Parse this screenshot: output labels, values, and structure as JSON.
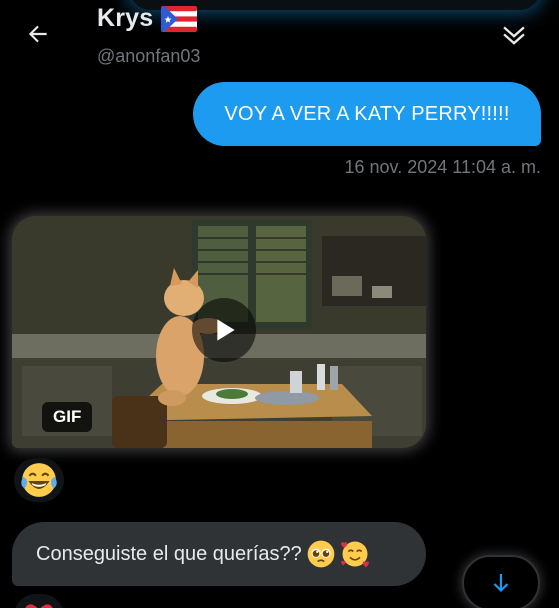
{
  "header": {
    "display_name": "Krys",
    "handle": "@anonfan03",
    "flag_icon": "puerto-rico-flag-icon",
    "back_icon": "arrow-left-icon",
    "collapse_icon": "double-chevron-down-icon"
  },
  "messages": {
    "outgoing_text": "VOY A VER A KATY PERRY!!!!!",
    "outgoing_timestamp": "16 nov. 2024 11:04 a. m.",
    "gif_badge": "GIF",
    "incoming_text": "Conseguiste el que querías??",
    "incoming_emojis": [
      "pleading-face-icon",
      "smiling-face-with-hearts-icon"
    ]
  },
  "reactions": {
    "gif_reaction": "face-with-tears-of-joy-icon",
    "text_reaction": "heart-icon"
  },
  "controls": {
    "scroll_down_icon": "arrow-down-icon"
  },
  "colors": {
    "accent": "#1d9bf0",
    "background": "#000000",
    "incoming_bubble": "#2f3336",
    "secondary_text": "#71767b"
  }
}
